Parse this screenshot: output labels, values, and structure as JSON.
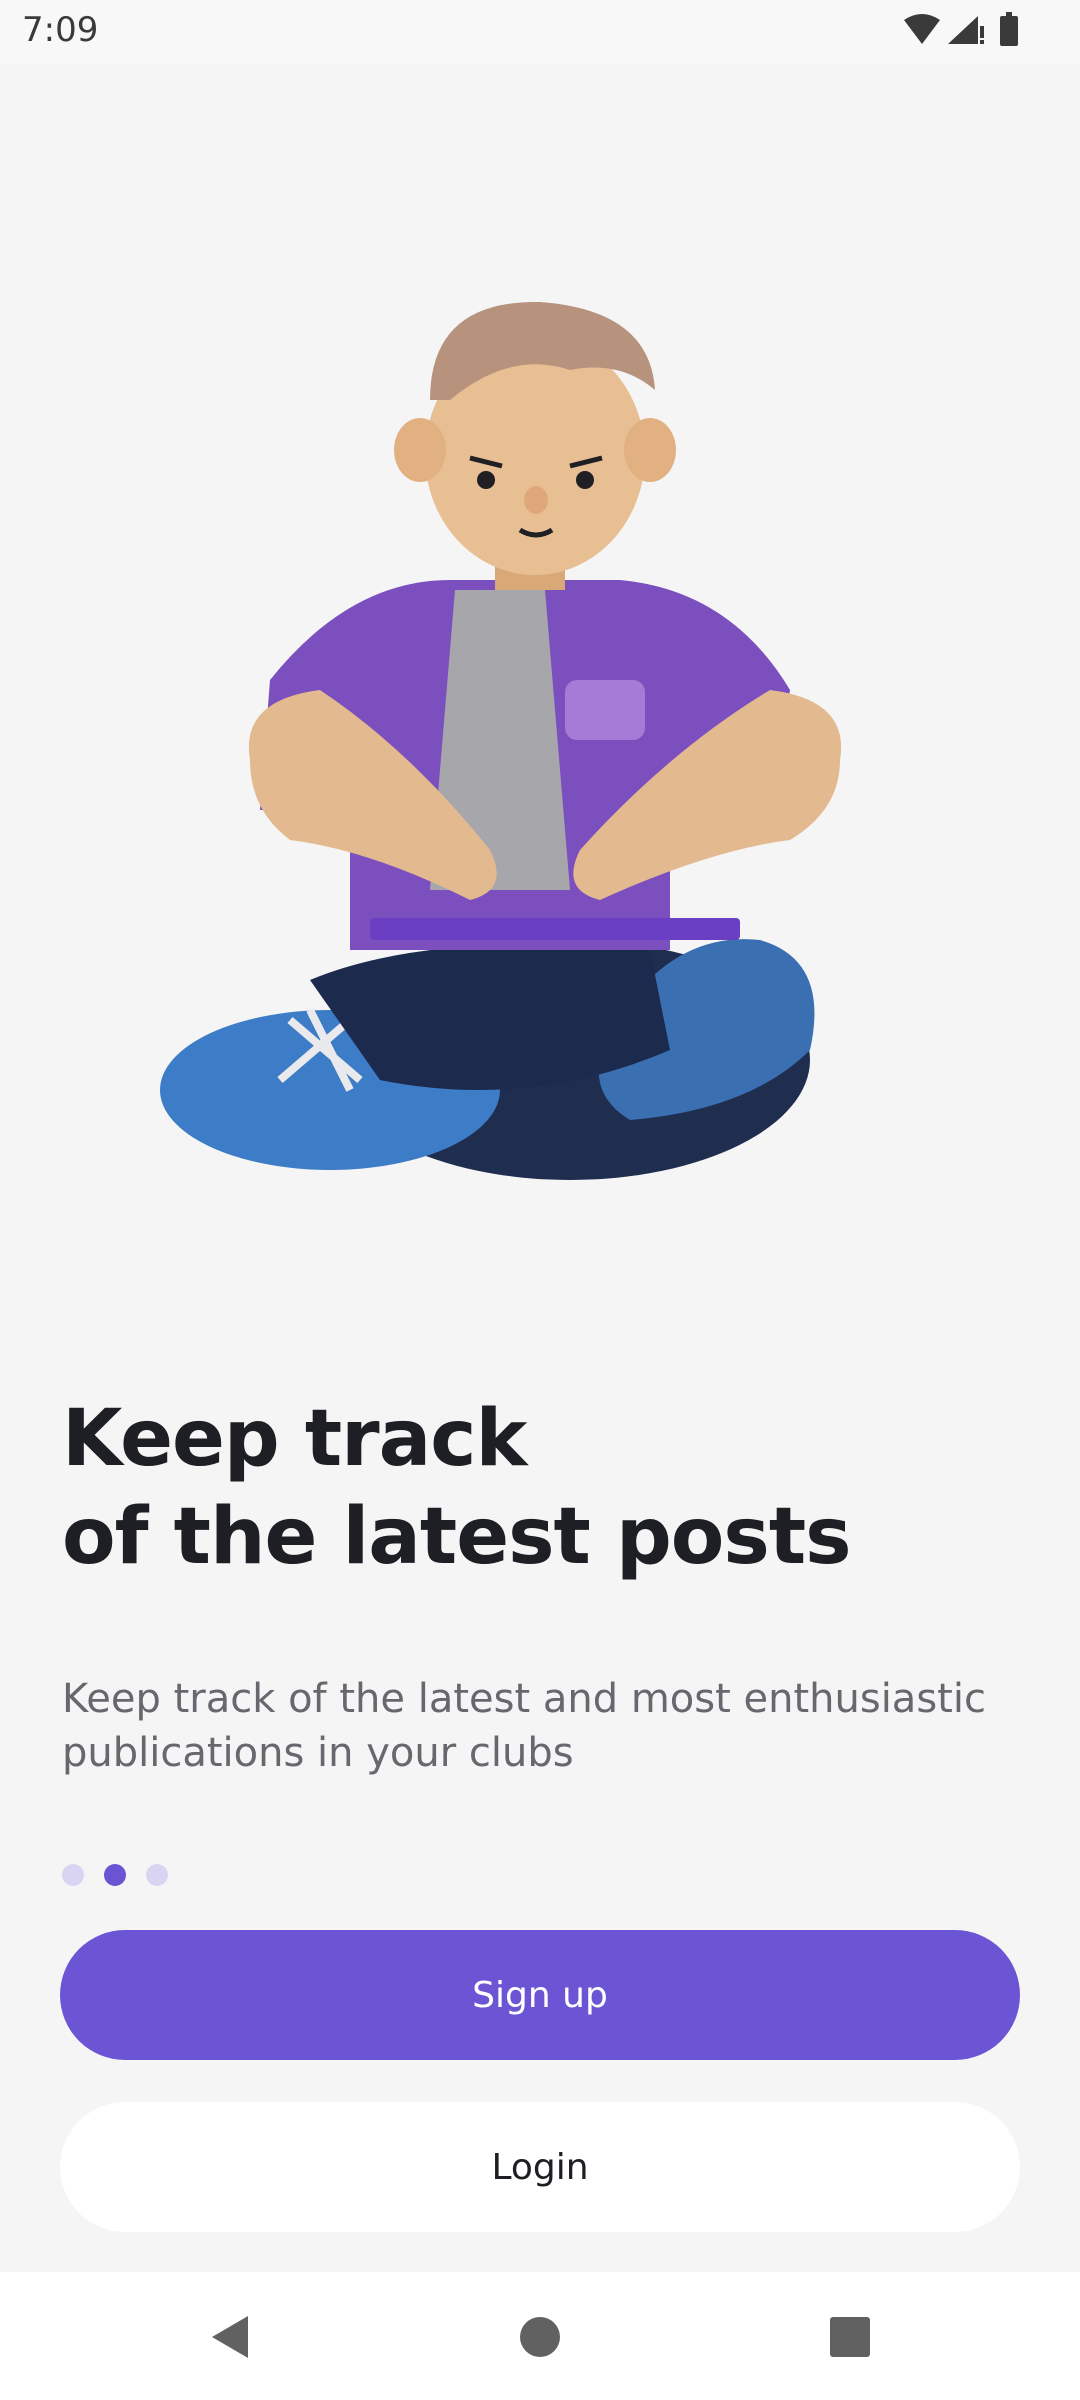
{
  "status_bar": {
    "time": "7:09",
    "icons": [
      "wifi-icon",
      "cellular-signal-icon",
      "battery-icon"
    ]
  },
  "onboarding": {
    "illustration": "3d-character-sitting-cross-legged",
    "headline_line1": "Keep track",
    "headline_line2": "of the latest posts",
    "subtitle": "Keep track of the latest and most enthusiastic publications in your clubs",
    "pagination": {
      "total": 3,
      "active_index": 1
    }
  },
  "actions": {
    "signup_label": "Sign up",
    "login_label": "Login"
  },
  "nav_bar": {
    "icons": [
      "back-icon",
      "home-icon",
      "recents-icon"
    ]
  },
  "colors": {
    "accent": "#6b55d4",
    "background": "#f5f5f6",
    "headline": "#1e1f24",
    "subtitle": "#67686e",
    "dot_inactive": "#d9d4f2"
  }
}
